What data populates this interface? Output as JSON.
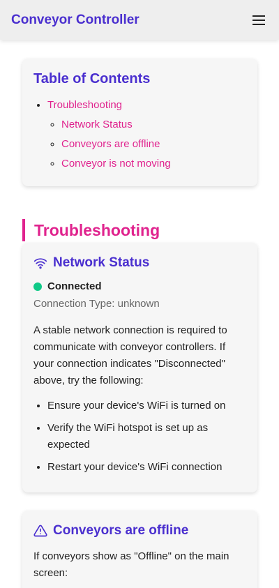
{
  "app": {
    "title": "Conveyor Controller",
    "menu_icon": "hamburger-menu-icon"
  },
  "toc": {
    "title": "Table of Contents",
    "items": [
      {
        "label": "Troubleshooting",
        "children": [
          {
            "label": "Network Status"
          },
          {
            "label": "Conveyors are offline"
          },
          {
            "label": "Conveyor is not moving"
          }
        ]
      }
    ]
  },
  "troubleshooting": {
    "heading": "Troubleshooting",
    "network": {
      "icon": "wifi-icon",
      "title": "Network Status",
      "status": "Connected",
      "status_color": "#10c987",
      "connection_type": "Connection Type: unknown",
      "description": "A stable network connection is required to communicate with conveyor controllers. If your connection indicates \"Disconnected\" above, try the following:",
      "steps": [
        "Ensure your device's WiFi is turned on",
        "Verify the WiFi hotspot is set up as expected",
        "Restart your device's WiFi connection"
      ]
    },
    "offline": {
      "icon": "warning-icon",
      "title": "Conveyors are offline",
      "description": "If conveyors show as \"Offline\" on the main screen:"
    }
  },
  "colors": {
    "accent": "#4a2fcf",
    "link": "#e0238e",
    "status_ok": "#10c987"
  }
}
